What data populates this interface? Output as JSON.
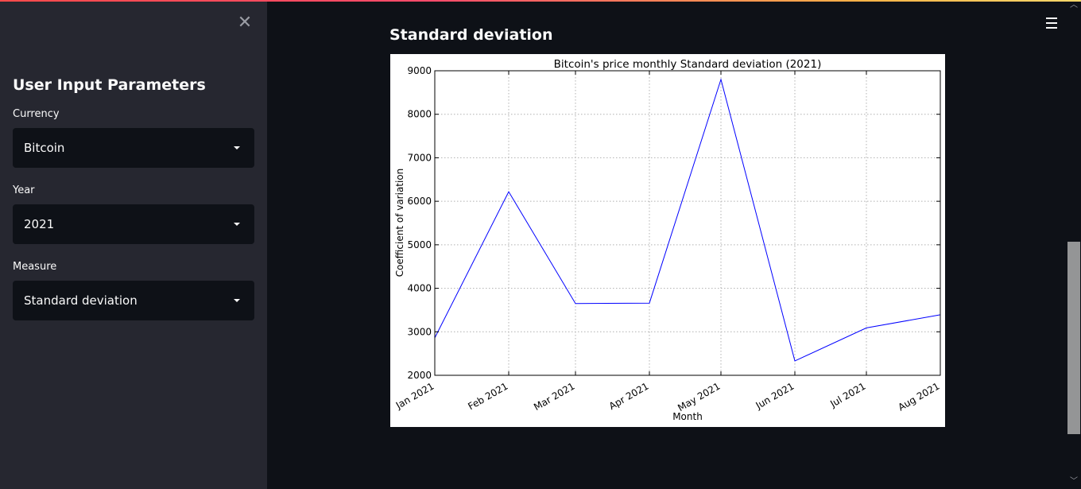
{
  "sidebar": {
    "close_icon": "close-icon",
    "title": "User Input Parameters",
    "fields": [
      {
        "label": "Currency",
        "value": "Bitcoin"
      },
      {
        "label": "Year",
        "value": "2021"
      },
      {
        "label": "Measure",
        "value": "Standard deviation"
      }
    ]
  },
  "main": {
    "menu_icon": "hamburger-menu-icon",
    "section_title": "Standard deviation"
  },
  "colors": {
    "sidebar_bg": "#262730",
    "main_bg": "#0e1117",
    "line": "#0000ff"
  },
  "chart_data": {
    "type": "line",
    "title": "Bitcoin's price monthly Standard deviation (2021)",
    "xlabel": "Month",
    "ylabel": "Coefficient of variation",
    "categories": [
      "Jan 2021",
      "Feb 2021",
      "Mar 2021",
      "Apr 2021",
      "May 2021",
      "Jun 2021",
      "Jul 2021",
      "Aug 2021"
    ],
    "x_days": [
      0,
      31,
      59,
      90,
      120,
      151,
      181,
      212
    ],
    "series": [
      {
        "x_days": [
          0,
          31,
          59,
          90,
          120,
          151,
          181,
          212
        ],
        "values": [
          2860,
          6220,
          3650,
          3660,
          8800,
          2330,
          3090,
          3390
        ]
      }
    ],
    "yticks": [
      2000,
      3000,
      4000,
      5000,
      6000,
      7000,
      8000,
      9000
    ],
    "ylim": [
      2000,
      9000
    ],
    "grid": true,
    "legend": "none"
  }
}
